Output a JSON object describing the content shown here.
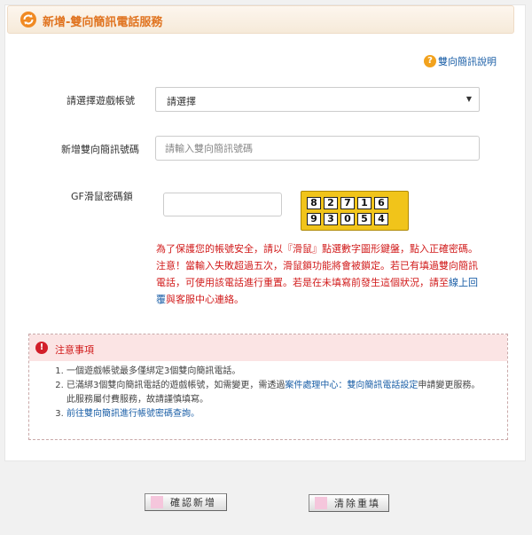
{
  "header": {
    "title": "新增-雙向簡訊電話服務",
    "icon": "refresh-icon"
  },
  "help_link": {
    "label": "雙向簡訊說明",
    "icon": "help-icon"
  },
  "form": {
    "account": {
      "label": "請選擇遊戲帳號",
      "selected": "請選擇"
    },
    "phone": {
      "label": "新增雙向簡訊號碼",
      "placeholder": "請輸入雙向簡訊號碼"
    },
    "password": {
      "label": "GF滑鼠密碼鎖",
      "value": ""
    },
    "keypad": {
      "row1": [
        "8",
        "2",
        "7",
        "1",
        "6"
      ],
      "row2": [
        "9",
        "3",
        "0",
        "5",
        "4"
      ]
    }
  },
  "warning": {
    "part1": "為了保護您的帳號安全，請以『滑鼠』點選數字圖形鍵盤，點入正確密碼。 注意！當輸入失敗超過五次，滑鼠鎖功能將會被鎖定。若已有填過雙向簡訊電話，可使用該電話進行重置。若是在未填寫前發生這個狀況，請至",
    "link": "線上回覆",
    "part2": "與客服中心連絡。"
  },
  "notice": {
    "title": "注意事項",
    "item1": "一個遊戲帳號最多僅綁定3個雙向簡訊電話。",
    "item2_a": "已滿綁3個雙向簡訊電話的遊戲帳號，如需變更，需透過",
    "item2_link": "案件處理中心：雙向簡訊電話設定",
    "item2_b": "申請變更服務。此服務屬付費服務，故請謹慎填寫。",
    "item3": "前往雙向簡訊進行帳號密碼查詢。"
  },
  "buttons": {
    "confirm": "確認新增",
    "clear": "清除重填"
  },
  "colors": {
    "accent": "#e0731f",
    "warning": "#d11b1b",
    "link": "#1b5fa7"
  }
}
